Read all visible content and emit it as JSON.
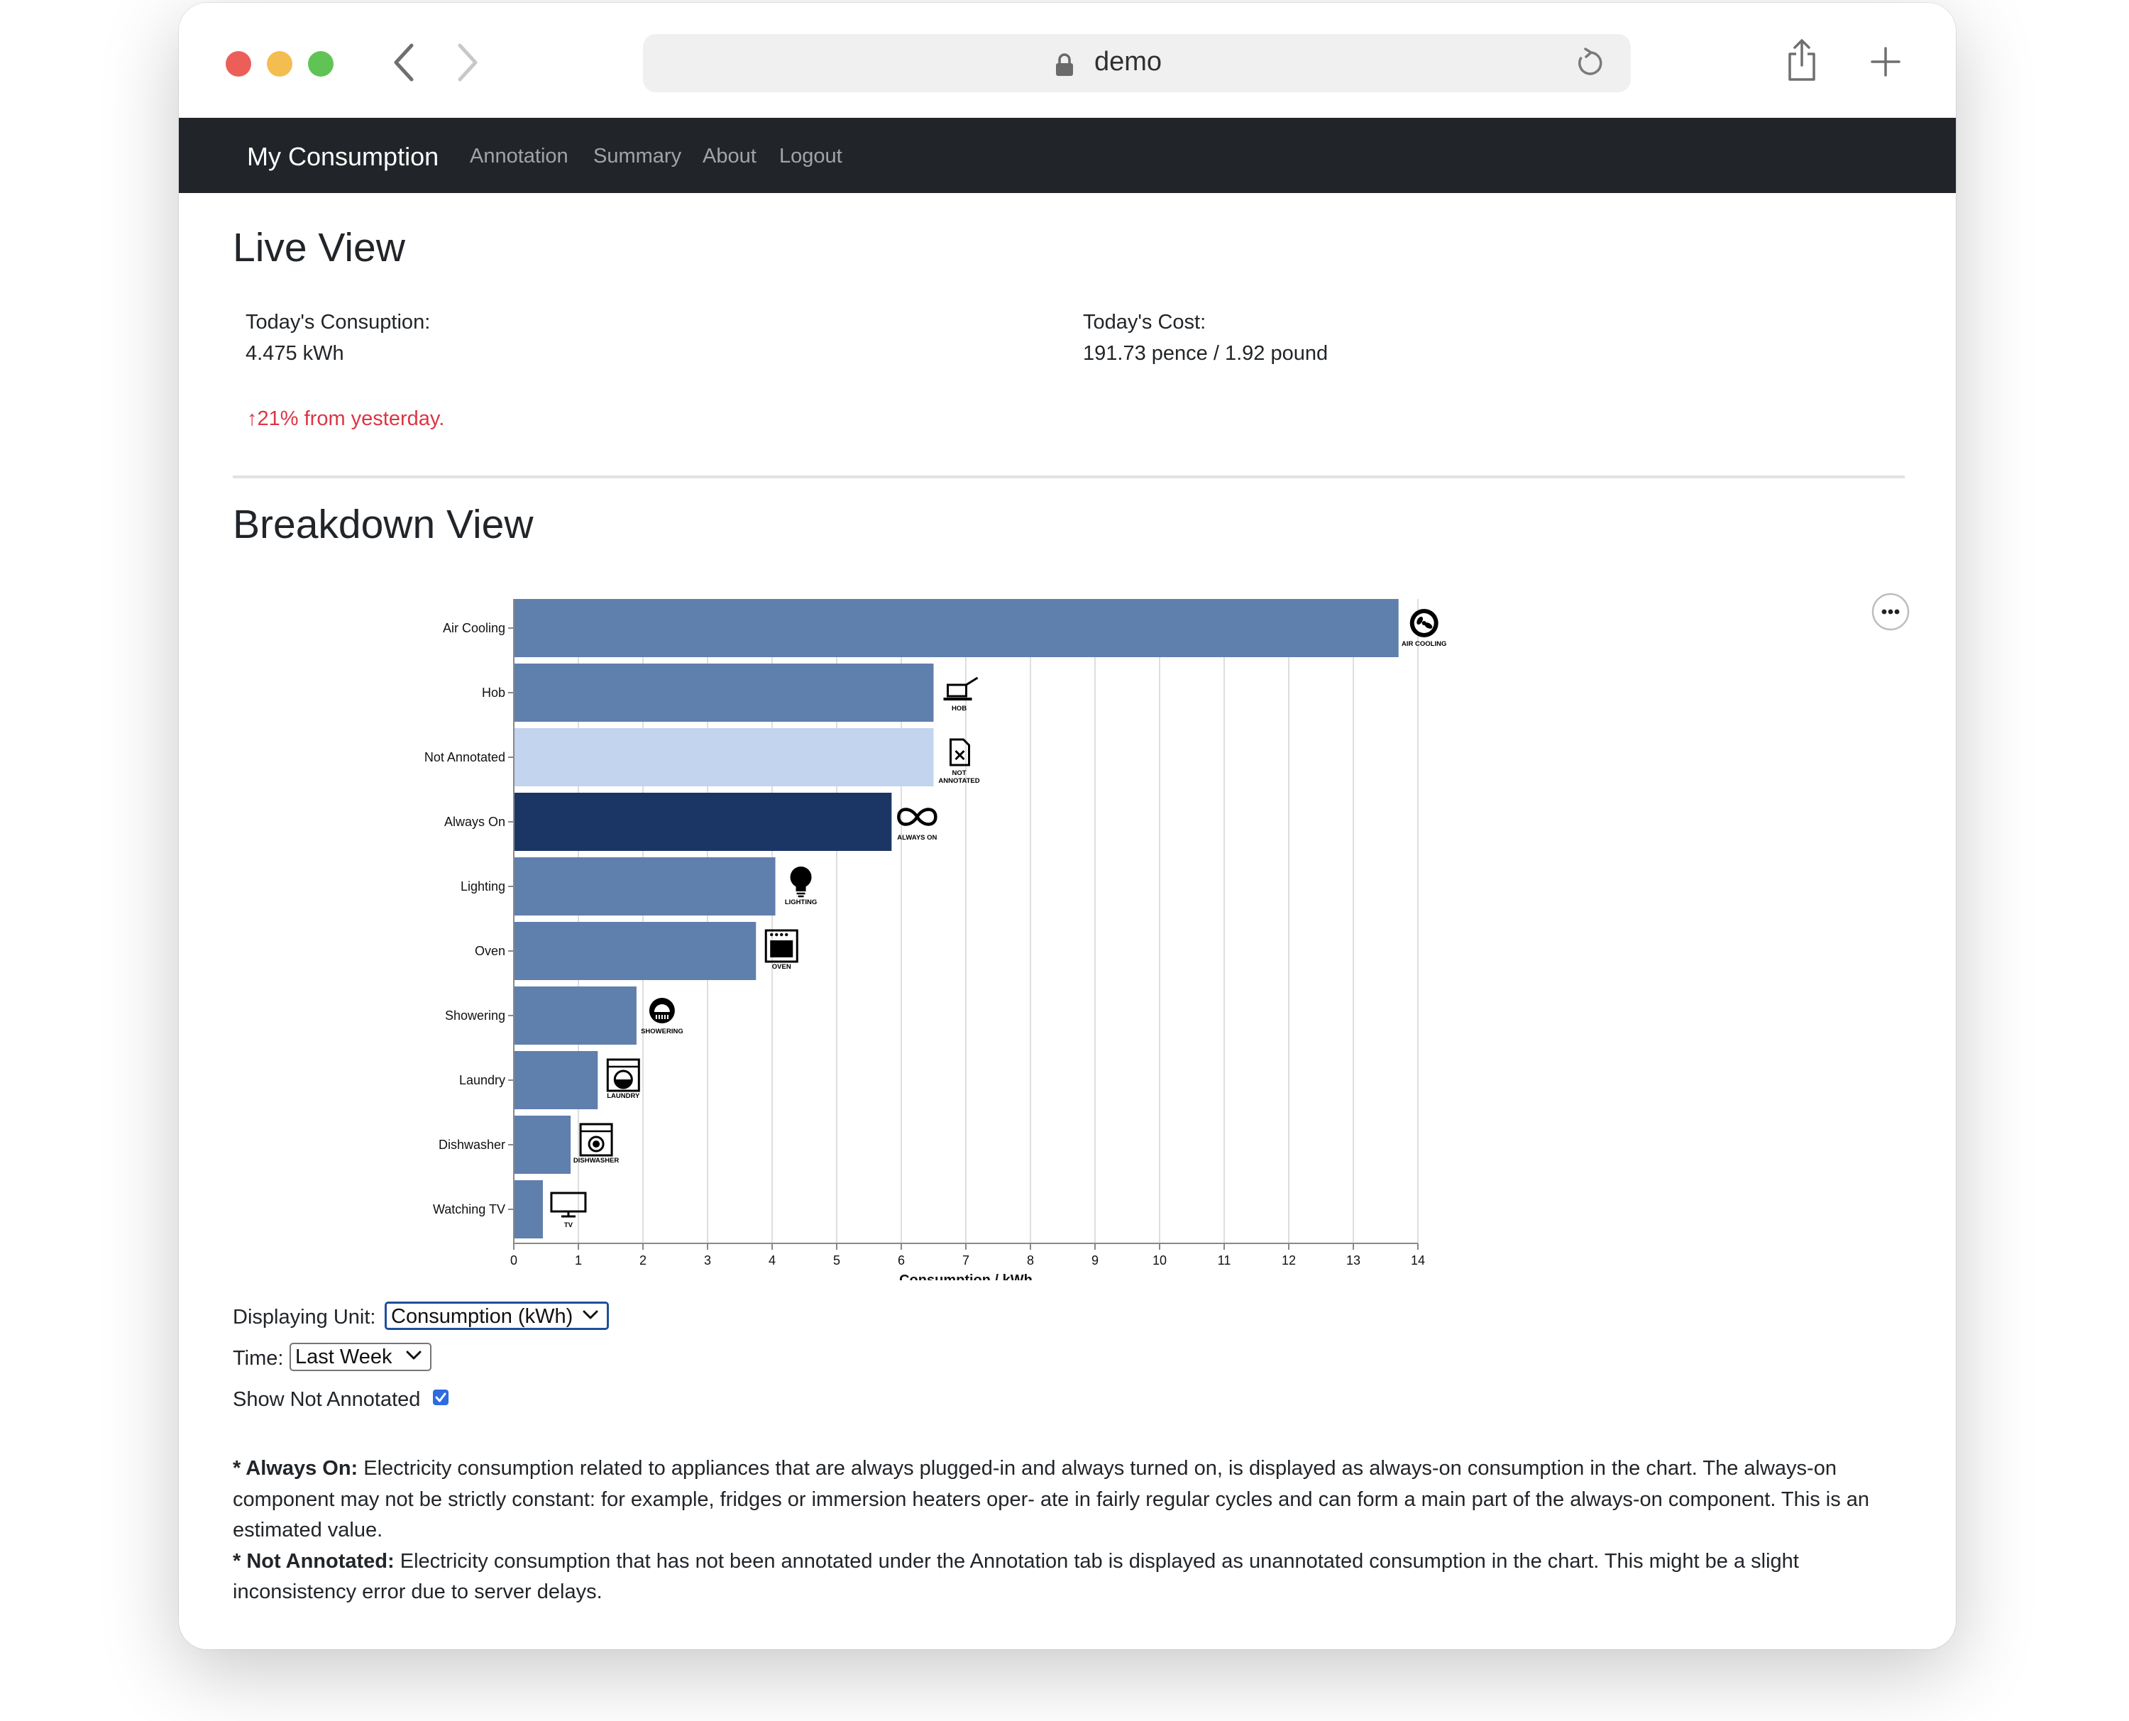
{
  "browser": {
    "url": "demo"
  },
  "navbar": {
    "brand": "My Consumption",
    "links": [
      "Annotation",
      "Summary",
      "About",
      "Logout"
    ]
  },
  "live_view": {
    "title": "Live View",
    "consumption_label": "Today's Consuption:",
    "consumption_value": "4.475 kWh",
    "cost_label": "Today's Cost:",
    "cost_value": "191.73 pence / 1.92 pound",
    "trend_text": "↑21% from yesterday."
  },
  "breakdown_view": {
    "title": "Breakdown View",
    "controls": {
      "unit_label": "Displaying Unit:",
      "unit_value": "Consumption (kWh)",
      "time_label": "Time:",
      "time_value": "Last Week",
      "show_not_annotated_label": "Show Not Annotated",
      "show_not_annotated_checked": true
    },
    "notes": [
      {
        "term": "* Always On:",
        "text": " Electricity consumption related to appliances that are always plugged-in and always turned on, is displayed as always-on consumption in the chart. The always-on component may not be strictly constant: for example, fridges or immersion heaters oper- ate in fairly regular cycles and can form a main part of the always-on component. This is an estimated value."
      },
      {
        "term": "* Not Annotated:",
        "text": " Electricity consumption that has not been annotated under the Annotation tab is displayed as unannotated consumption in the chart. This might be a slight inconsistency error due to server delays."
      }
    ]
  },
  "chart_data": {
    "type": "bar",
    "orientation": "horizontal",
    "xlabel": "Consumption / kWh",
    "xlim": [
      0,
      14
    ],
    "xticks": [
      "0",
      "1",
      "2",
      "3",
      "4",
      "5",
      "6",
      "7",
      "8",
      "9",
      "10",
      "11",
      "12",
      "13",
      "14"
    ],
    "grid": true,
    "categories": [
      "Air Cooling",
      "Hob",
      "Not Annotated",
      "Always On",
      "Lighting",
      "Oven",
      "Showering",
      "Laundry",
      "Dishwasher",
      "Watching TV"
    ],
    "values": [
      13.7,
      6.5,
      6.5,
      5.85,
      4.05,
      3.75,
      1.9,
      1.3,
      0.88,
      0.45
    ],
    "icon_labels": [
      [
        "AIR COOLING"
      ],
      [
        "HOB"
      ],
      [
        "NOT",
        "ANNOTATED"
      ],
      [
        "ALWAYS ON"
      ],
      [
        "LIGHTING"
      ],
      [
        "OVEN"
      ],
      [
        "SHOWERING"
      ],
      [
        "LAUNDRY"
      ],
      [
        "DISHWASHER"
      ],
      [
        "TV"
      ]
    ],
    "icons": [
      "fan-icon",
      "pan-icon",
      "unknown-file-icon",
      "infinity-icon",
      "bulb-icon",
      "oven-icon",
      "shower-icon",
      "washing-machine-icon",
      "dishwasher-icon",
      "tv-icon"
    ],
    "colors": [
      "#5f7fad",
      "#5f7fad",
      "#c2d4ee",
      "#1b3664",
      "#5f7fad",
      "#5f7fad",
      "#5f7fad",
      "#5f7fad",
      "#5f7fad",
      "#5f7fad"
    ]
  }
}
